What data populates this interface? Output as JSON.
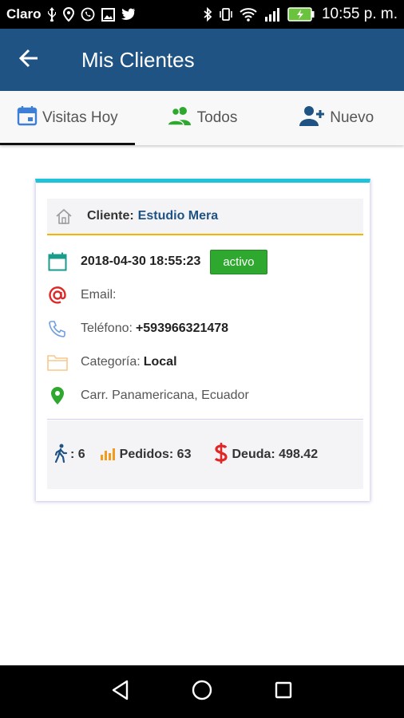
{
  "status_bar": {
    "carrier": "Claro",
    "time": "10:55 p. m.",
    "icons": [
      "usb-icon",
      "location-icon",
      "whatsapp-icon",
      "gallery-icon",
      "twitter-icon",
      "bluetooth-icon",
      "vibrate-icon",
      "wifi-icon",
      "signal-icon",
      "battery-icon"
    ]
  },
  "app_bar": {
    "title": "Mis Clientes",
    "back_icon": "arrow-left-icon"
  },
  "tabs": [
    {
      "label": "Visitas Hoy",
      "icon": "calendar-icon",
      "active": true,
      "color": "#3d7fd6"
    },
    {
      "label": "Todos",
      "icon": "users-icon",
      "active": false,
      "color": "#2fa82f"
    },
    {
      "label": "Nuevo",
      "icon": "add-user-icon",
      "active": false,
      "color": "#1f5384"
    }
  ],
  "card": {
    "client_label": "Cliente:",
    "client_name": "Estudio Mera",
    "date": "2018-04-30 18:55:23",
    "status": "activo",
    "email_label": "Email:",
    "phone_label": "Teléfono:",
    "phone_value": "+593966321478",
    "category_label": "Categoría:",
    "category_value": "Local",
    "address": "Carr. Panamericana, Ecuador",
    "visits": ": 6",
    "orders": "Pedidos: 63",
    "debt": "Deuda: 498.42"
  },
  "colors": {
    "app_bar": "#1f5384",
    "card_top": "#1ec3d9",
    "badge": "#2fa82f",
    "divider": "#f4b400"
  }
}
